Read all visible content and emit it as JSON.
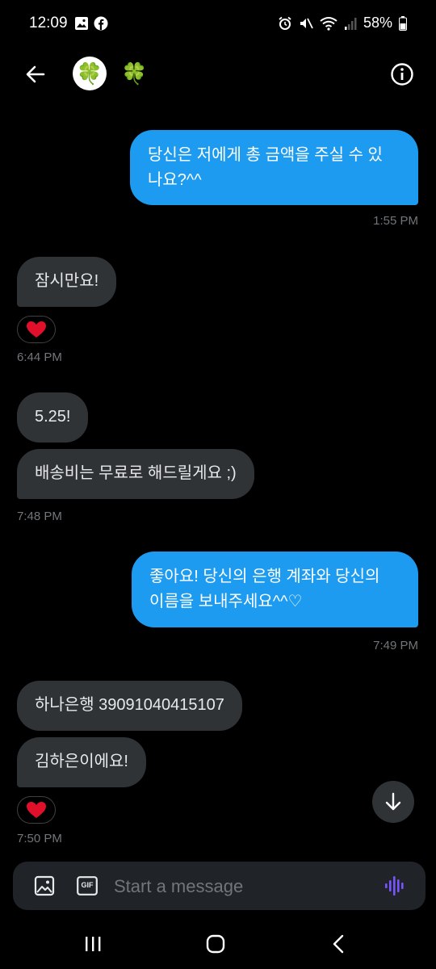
{
  "status": {
    "time": "12:09",
    "battery": "58%"
  },
  "header": {
    "avatar_emoji": "🍀",
    "name": "🍀"
  },
  "messages": [
    {
      "direction": "out",
      "text_lines": [
        "당신은 저에게 총 금액을 주실 수 있",
        "나요?^^"
      ],
      "time": "1:55 PM"
    },
    {
      "direction": "in",
      "text": "잠시만요!",
      "reaction": "❤️",
      "time": "6:44 PM"
    },
    {
      "direction": "in",
      "text": "5.25!"
    },
    {
      "direction": "in",
      "text": "배송비는 무료로 해드릴게요 ;)",
      "time": "7:48 PM"
    },
    {
      "direction": "out",
      "text_lines": [
        "좋아요! 당신의 은행 계좌와 당신의",
        "이름을 보내주세요^^♡"
      ],
      "time": "7:49 PM"
    },
    {
      "direction": "in",
      "text": "하나은행 39091040415107"
    },
    {
      "direction": "in",
      "text": "김하은이에요!",
      "reaction": "❤️",
      "time": "7:50 PM"
    }
  ],
  "composer": {
    "placeholder": "Start a message",
    "gif_label": "GIF"
  },
  "colors": {
    "outgoing_bubble": "#1d9bf0",
    "incoming_bubble": "#2f3336",
    "background": "#000000",
    "voice_accent": "#7856ff"
  }
}
